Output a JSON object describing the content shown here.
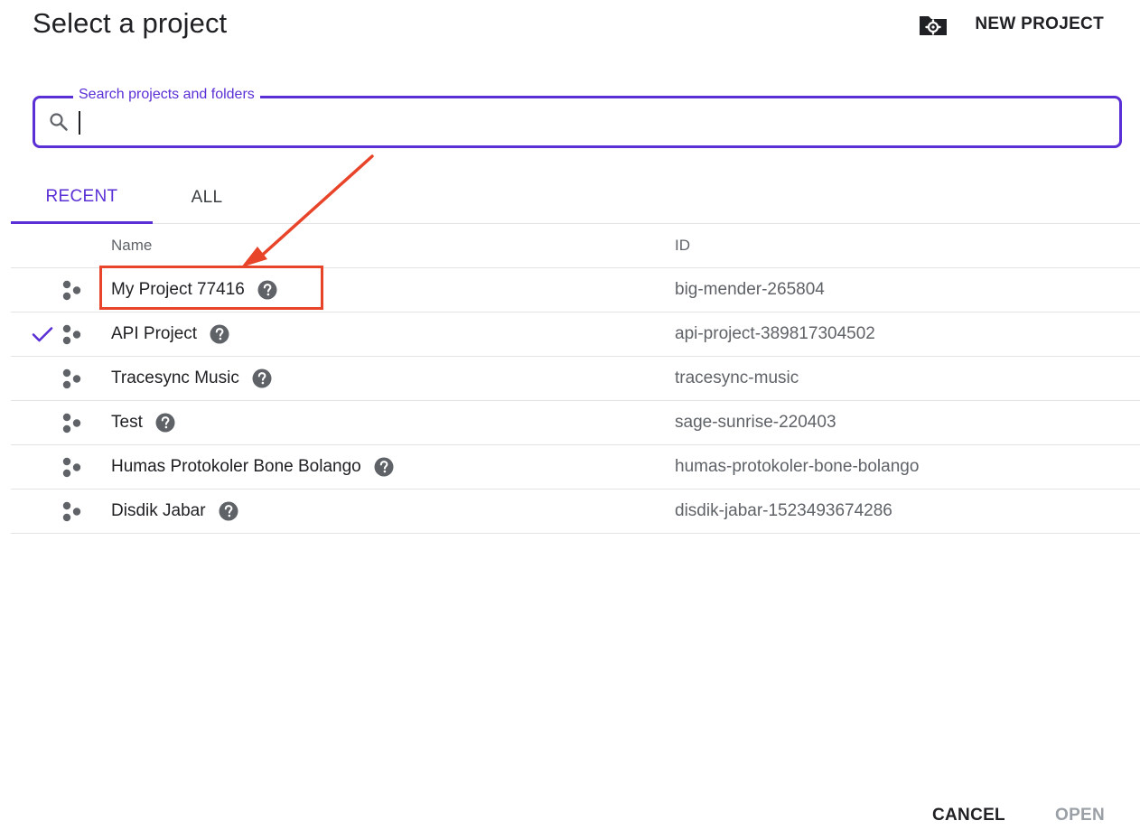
{
  "dialog": {
    "title": "Select a project",
    "new_project_label": "NEW PROJECT",
    "new_project_icon": "new-project-icon"
  },
  "search": {
    "label": "Search projects and folders",
    "value": "",
    "placeholder": "",
    "icon": "search-icon"
  },
  "tabs": [
    {
      "label": "RECENT",
      "active": true
    },
    {
      "label": "ALL",
      "active": false
    }
  ],
  "table": {
    "columns": [
      "Name",
      "ID"
    ],
    "rows": [
      {
        "name": "My Project 77416",
        "id": "big-mender-265804",
        "selected": false
      },
      {
        "name": "API Project",
        "id": "api-project-389817304502",
        "selected": true
      },
      {
        "name": "Tracesync Music",
        "id": "tracesync-music",
        "selected": false
      },
      {
        "name": "Test",
        "id": "sage-sunrise-220403",
        "selected": false
      },
      {
        "name": "Humas Protokoler Bone Bolango",
        "id": "humas-protokoler-bone-bolango",
        "selected": false
      },
      {
        "name": "Disdik Jabar",
        "id": "disdik-jabar-1523493674286",
        "selected": false
      }
    ]
  },
  "footer": {
    "cancel_label": "CANCEL",
    "open_label": "OPEN"
  },
  "colors": {
    "accent": "#5b2fd6",
    "annotation": "#e8442a",
    "disabled": "#9aa0a6"
  }
}
